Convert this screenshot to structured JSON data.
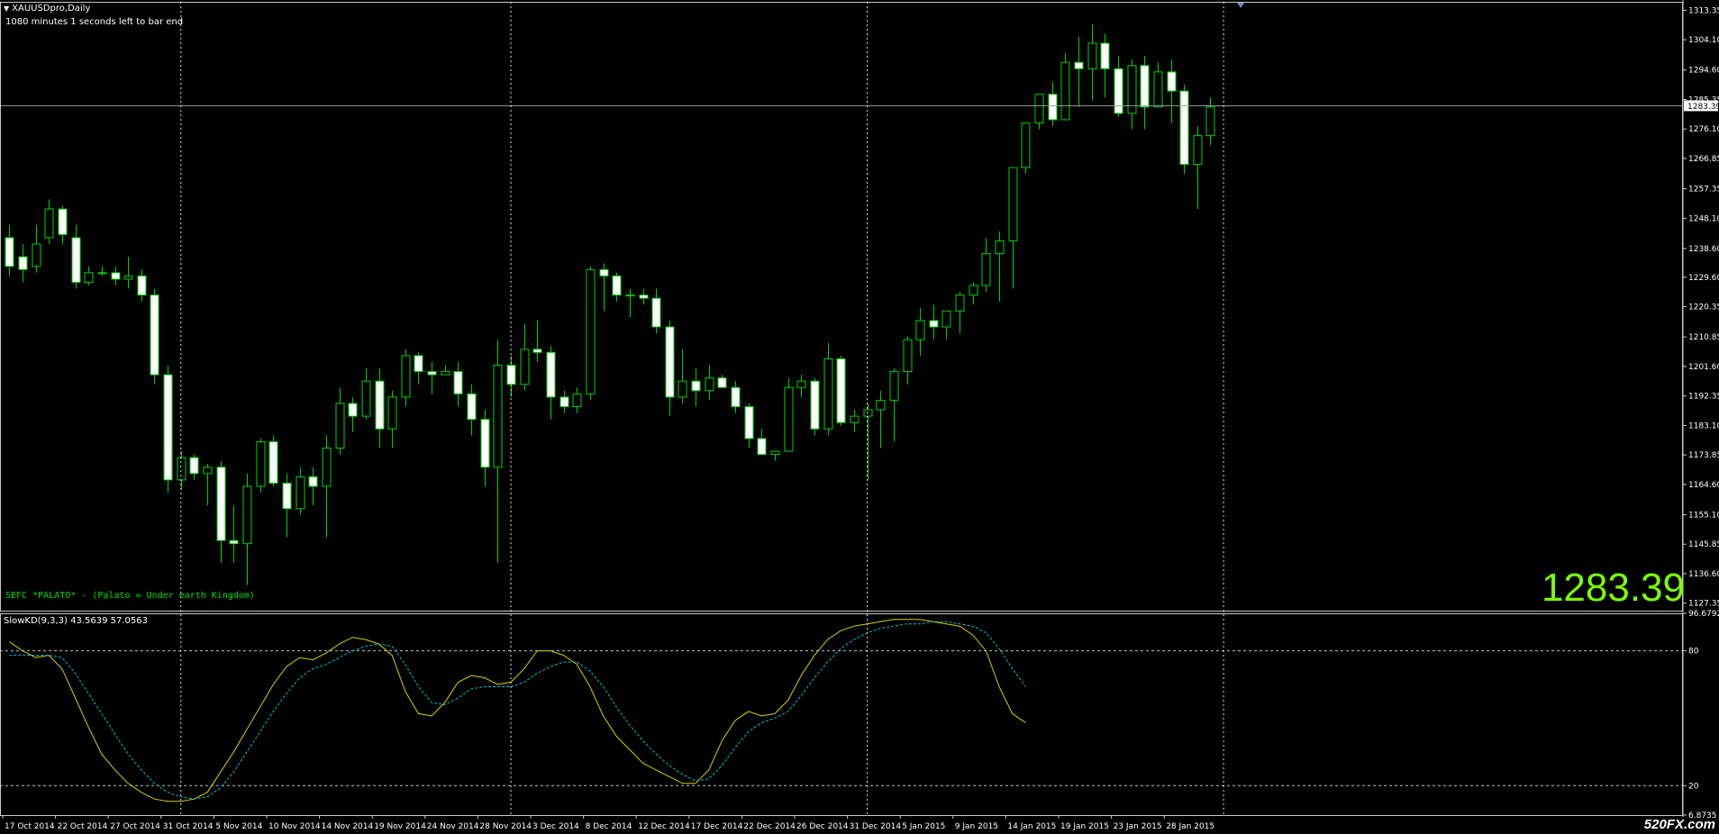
{
  "window": {
    "symbol_title": "XAUUSDpro,Daily",
    "timer_text": "1080 minutes 1 seconds left to bar end",
    "comment": "SEFC *PALATO* - (Palato = Under earth Kingdom)",
    "big_price": "1283.39",
    "indicator_label": "SlowKD(9,3,3) 43.5639 57.0563",
    "watermark": "520FX.com",
    "icons": [
      "dropdown-triangle-icon",
      "shift-marker-icon"
    ]
  },
  "colors": {
    "background": "#000000",
    "bull_candle": "#00d200",
    "bear_candle_body": "#ffffff",
    "grid": "#ffffff",
    "k_line": "#d8d000",
    "d_line": "#00c0d0",
    "big_price": "#7cfc00",
    "comment": "#00e000"
  },
  "chart_data": [
    {
      "type": "candlestick",
      "title": "XAUUSDpro,Daily",
      "y_ticks": [
        "1313.35",
        "1304.10",
        "1294.60",
        "1285.35",
        "1276.10",
        "1266.85",
        "1257.35",
        "1248.10",
        "1238.60",
        "1229.60",
        "1220.35",
        "1210.85",
        "1201.60",
        "1192.35",
        "1183.10",
        "1173.85",
        "1164.60",
        "1155.10",
        "1145.85",
        "1136.60",
        "1127.35"
      ],
      "current_price_label": "1283.39",
      "current_price": 1283.39,
      "ylim": [
        1125,
        1316
      ],
      "x_ticks": [
        "17 Oct 2014",
        "22 Oct 2014",
        "27 Oct 2014",
        "31 Oct 2014",
        "5 Nov 2014",
        "10 Nov 2014",
        "14 Nov 2014",
        "19 Nov 2014",
        "24 Nov 2014",
        "28 Nov 2014",
        "3 Dec 2014",
        "8 Dec 2014",
        "12 Dec 2014",
        "17 Dec 2014",
        "22 Dec 2014",
        "26 Dec 2014",
        "31 Dec 2014",
        "5 Jan 2015",
        "9 Jan 2015",
        "14 Jan 2015",
        "19 Jan 2015",
        "23 Jan 2015",
        "28 Jan 2015"
      ],
      "tick_bar_index": [
        0,
        4,
        8,
        12,
        16,
        20,
        24,
        28,
        32,
        36,
        40,
        44,
        48,
        52,
        56,
        60,
        64,
        68,
        72,
        76,
        80,
        84,
        88
      ],
      "separator_bar_index": [
        13,
        38,
        65,
        92
      ],
      "candles": [
        [
          1242,
          1246,
          1230,
          1233
        ],
        [
          1236,
          1240,
          1228,
          1232
        ],
        [
          1233,
          1246,
          1231,
          1240
        ],
        [
          1242,
          1254,
          1240,
          1251
        ],
        [
          1251,
          1252,
          1240,
          1243
        ],
        [
          1242,
          1246,
          1226,
          1228
        ],
        [
          1228,
          1233,
          1227,
          1231
        ],
        [
          1231,
          1233,
          1230,
          1231
        ],
        [
          1231,
          1233,
          1227,
          1229
        ],
        [
          1229,
          1236,
          1226,
          1230
        ],
        [
          1230,
          1232,
          1222,
          1224
        ],
        [
          1224,
          1226,
          1196,
          1199
        ],
        [
          1199,
          1202,
          1162,
          1166
        ],
        [
          1166,
          1175,
          1163,
          1173
        ],
        [
          1173,
          1174,
          1166,
          1168
        ],
        [
          1168,
          1171,
          1158,
          1170
        ],
        [
          1170,
          1172,
          1140,
          1147
        ],
        [
          1147,
          1158,
          1140,
          1146
        ],
        [
          1146,
          1168,
          1133,
          1164
        ],
        [
          1164,
          1179,
          1162,
          1178
        ],
        [
          1178,
          1180,
          1164,
          1165
        ],
        [
          1165,
          1168,
          1148,
          1157
        ],
        [
          1157,
          1170,
          1155,
          1167
        ],
        [
          1167,
          1170,
          1158,
          1164
        ],
        [
          1164,
          1180,
          1148,
          1176
        ],
        [
          1176,
          1195,
          1174,
          1190
        ],
        [
          1190,
          1192,
          1181,
          1186
        ],
        [
          1186,
          1201,
          1185,
          1197
        ],
        [
          1197,
          1201,
          1176,
          1182
        ],
        [
          1182,
          1194,
          1176,
          1192
        ],
        [
          1192,
          1207,
          1189,
          1205
        ],
        [
          1205,
          1206,
          1196,
          1200
        ],
        [
          1200,
          1203,
          1193,
          1199
        ],
        [
          1199,
          1202,
          1199,
          1200
        ],
        [
          1200,
          1203,
          1189,
          1193
        ],
        [
          1193,
          1196,
          1180,
          1185
        ],
        [
          1185,
          1188,
          1164,
          1170
        ],
        [
          1170,
          1210,
          1140,
          1202
        ],
        [
          1202,
          1205,
          1192,
          1196
        ],
        [
          1196,
          1215,
          1194,
          1207
        ],
        [
          1207,
          1216,
          1203,
          1206
        ],
        [
          1206,
          1208,
          1185,
          1192
        ],
        [
          1192,
          1194,
          1187,
          1189
        ],
        [
          1189,
          1195,
          1187,
          1193
        ],
        [
          1193,
          1233,
          1191,
          1232
        ],
        [
          1232,
          1234,
          1219,
          1230
        ],
        [
          1230,
          1231,
          1222,
          1224
        ],
        [
          1224,
          1226,
          1217,
          1224
        ],
        [
          1224,
          1226,
          1221,
          1223
        ],
        [
          1223,
          1226,
          1212,
          1214
        ],
        [
          1214,
          1216,
          1186,
          1192
        ],
        [
          1192,
          1207,
          1190,
          1197
        ],
        [
          1197,
          1201,
          1189,
          1194
        ],
        [
          1194,
          1202,
          1191,
          1198
        ],
        [
          1198,
          1199,
          1195,
          1195
        ],
        [
          1195,
          1197,
          1187,
          1189
        ],
        [
          1189,
          1190,
          1176,
          1179
        ],
        [
          1179,
          1182,
          1174,
          1174
        ],
        [
          1174,
          1175,
          1172,
          1175
        ],
        [
          1175,
          1198,
          1175,
          1195
        ],
        [
          1195,
          1199,
          1192,
          1197
        ],
        [
          1197,
          1198,
          1180,
          1182
        ],
        [
          1182,
          1209,
          1180,
          1204
        ],
        [
          1204,
          1205,
          1183,
          1184
        ],
        [
          1184,
          1188,
          1181,
          1186
        ],
        [
          1186,
          1190,
          1166,
          1188
        ],
        [
          1188,
          1194,
          1176,
          1191
        ],
        [
          1191,
          1201,
          1178,
          1200
        ],
        [
          1200,
          1211,
          1196,
          1210
        ],
        [
          1210,
          1220,
          1205,
          1216
        ],
        [
          1216,
          1221,
          1210,
          1214
        ],
        [
          1214,
          1218,
          1210,
          1219
        ],
        [
          1219,
          1225,
          1212,
          1224
        ],
        [
          1224,
          1228,
          1221,
          1227
        ],
        [
          1227,
          1242,
          1225,
          1237
        ],
        [
          1237,
          1244,
          1222,
          1241
        ],
        [
          1241,
          1264,
          1226,
          1264
        ],
        [
          1264,
          1278,
          1262,
          1278
        ],
        [
          1278,
          1284,
          1276,
          1287
        ],
        [
          1287,
          1291,
          1277,
          1279
        ],
        [
          1279,
          1300,
          1279,
          1297
        ],
        [
          1297,
          1305,
          1283,
          1295
        ],
        [
          1295,
          1309,
          1285,
          1303
        ],
        [
          1303,
          1306,
          1286,
          1295
        ],
        [
          1295,
          1299,
          1280,
          1281
        ],
        [
          1281,
          1298,
          1276,
          1296
        ],
        [
          1296,
          1299,
          1276,
          1283
        ],
        [
          1283,
          1297,
          1283,
          1294
        ],
        [
          1294,
          1298,
          1278,
          1288
        ],
        [
          1288,
          1290,
          1262,
          1265
        ],
        [
          1265,
          1277,
          1251,
          1274
        ],
        [
          1274,
          1286,
          1271,
          1283
        ]
      ]
    },
    {
      "type": "line",
      "title": "SlowKD(9,3,3) 43.5639 57.0563",
      "y_ticks": [
        "96.6792",
        "80",
        "20",
        "6.8735"
      ],
      "ylim": [
        6.8735,
        96.6792
      ],
      "levels": [
        80,
        20
      ],
      "series": [
        {
          "name": "",
          "values": [
            84,
            80,
            77,
            78,
            72,
            59,
            46,
            34,
            27,
            21,
            17,
            14,
            13,
            13,
            14,
            17,
            26,
            35,
            45,
            55,
            65,
            73,
            77,
            76,
            79,
            83,
            86,
            85,
            83,
            78,
            62,
            52,
            51,
            57,
            66,
            69,
            68,
            65,
            66,
            72,
            80,
            80,
            78,
            74,
            64,
            51,
            42,
            36,
            30,
            27,
            24,
            21,
            21,
            27,
            40,
            49,
            53,
            51,
            52,
            58,
            69,
            78,
            85,
            89,
            91,
            92,
            93,
            94,
            94,
            94,
            93,
            92,
            91,
            87,
            80,
            64,
            52,
            48
          ]
        },
        {
          "name": "",
          "values": [
            78,
            78,
            78,
            78,
            77,
            70,
            61,
            52,
            43,
            34,
            27,
            21,
            17,
            15,
            14,
            15,
            19,
            26,
            35,
            44,
            53,
            61,
            68,
            72,
            74,
            77,
            80,
            82,
            83,
            82,
            74,
            64,
            57,
            56,
            59,
            63,
            64,
            64,
            64,
            66,
            70,
            73,
            75,
            75,
            71,
            64,
            55,
            47,
            40,
            34,
            29,
            25,
            22,
            23,
            29,
            37,
            44,
            48,
            50,
            53,
            60,
            68,
            75,
            81,
            85,
            88,
            90,
            91,
            92,
            92,
            93,
            93,
            92,
            91,
            88,
            81,
            72,
            64
          ]
        }
      ]
    }
  ]
}
